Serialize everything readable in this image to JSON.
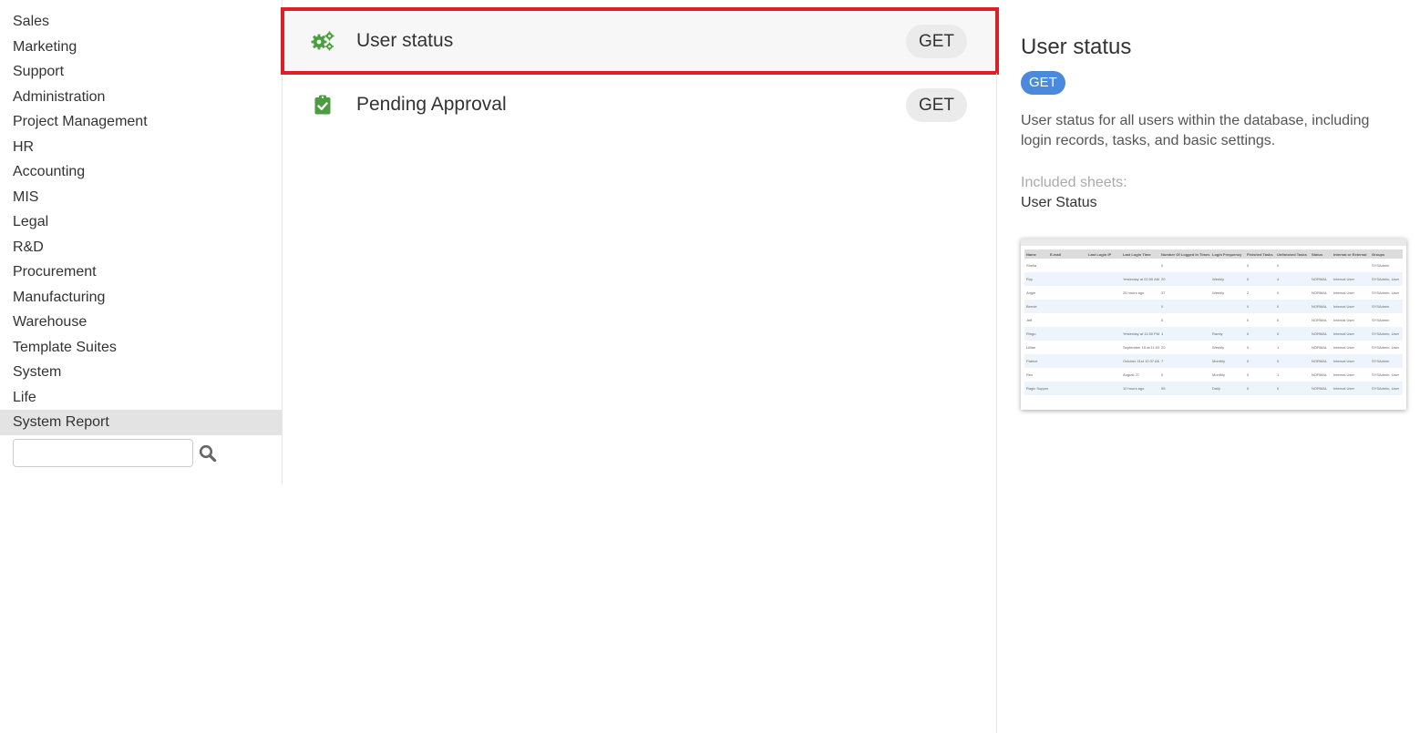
{
  "sidebar": {
    "items": [
      {
        "label": "Sales"
      },
      {
        "label": "Marketing"
      },
      {
        "label": "Support"
      },
      {
        "label": "Administration"
      },
      {
        "label": "Project Management"
      },
      {
        "label": "HR"
      },
      {
        "label": "Accounting"
      },
      {
        "label": "MIS"
      },
      {
        "label": "Legal"
      },
      {
        "label": "R&D"
      },
      {
        "label": "Procurement"
      },
      {
        "label": "Manufacturing"
      },
      {
        "label": "Warehouse"
      },
      {
        "label": "Template Suites"
      },
      {
        "label": "System"
      },
      {
        "label": "Life"
      },
      {
        "label": "System Report"
      }
    ],
    "active_index": 16,
    "search": {
      "value": "",
      "placeholder": ""
    }
  },
  "endpoints": [
    {
      "name": "User status",
      "method": "GET",
      "icon": "gears-icon",
      "selected": true
    },
    {
      "name": "Pending Approval",
      "method": "GET",
      "icon": "clipboard-check-icon",
      "selected": false
    }
  ],
  "detail": {
    "title": "User status",
    "method": "GET",
    "description": "User status for all users within the database, including login records, tasks, and basic settings.",
    "sheets_label": "Included sheets:",
    "sheets_value": "User Status"
  },
  "preview": {
    "headers": [
      "Name",
      "E-mail",
      "Last Login IP",
      "Last Login Time",
      "Number Of Logged In Times",
      "Login Frequency",
      "Finished Tasks",
      "Unfinished Tasks",
      "Status",
      "Internal or External",
      "Groups"
    ],
    "rows": [
      [
        "Shelia",
        "",
        "",
        "",
        "0",
        "",
        "0",
        "0",
        "",
        "",
        "SYSAdmin"
      ],
      [
        "Roy",
        "",
        "",
        "Yesterday at 02:50 AM",
        "20",
        "Weekly",
        "0",
        "4",
        "NORMAL",
        "Internal User",
        "SYSAdmin, User"
      ],
      [
        "Angie",
        "",
        "",
        "25 hours ago",
        "37",
        "Weekly",
        "2",
        "0",
        "NORMAL",
        "Internal User",
        "SYSAdmin, User"
      ],
      [
        "Bernie",
        "",
        "",
        "",
        "0",
        "",
        "0",
        "0",
        "NORMAL",
        "Internal User",
        "SYSAdmin"
      ],
      [
        "Jeff",
        "",
        "",
        "",
        "0",
        "",
        "0",
        "0",
        "NORMAL",
        "Internal User",
        "SYSAdmin"
      ],
      [
        "Ringo",
        "",
        "",
        "Yesterday at 11:50 PM",
        "1",
        "Rarely",
        "0",
        "0",
        "NORMAL",
        "Internal User",
        "SYSAdmin, User"
      ],
      [
        "Lillian",
        "",
        "",
        "September 15 at 11:53 PM",
        "20",
        "Weekly",
        "0",
        "1",
        "NORMAL",
        "Internal User",
        "SYSAdmin, User"
      ],
      [
        "Patrice",
        "",
        "",
        "October 31st 10:37 AM",
        "7",
        "Monthly",
        "0",
        "0",
        "NORMAL",
        "Internal User",
        "SYSAdmin"
      ],
      [
        "Rex",
        "",
        "",
        "August 27",
        "0",
        "Monthly",
        "0",
        "1",
        "NORMAL",
        "Internal User",
        "SYSAdmin, User"
      ],
      [
        "Ragic Support",
        "",
        "",
        "10 hours ago",
        "95",
        "Daily",
        "0",
        "0",
        "NORMAL",
        "Internal User",
        "SYSAdmin, User"
      ]
    ]
  },
  "colors": {
    "selected_outline": "#de1f26",
    "method_badge": "#4a89dc",
    "icon_green": "#4a9e3f"
  }
}
